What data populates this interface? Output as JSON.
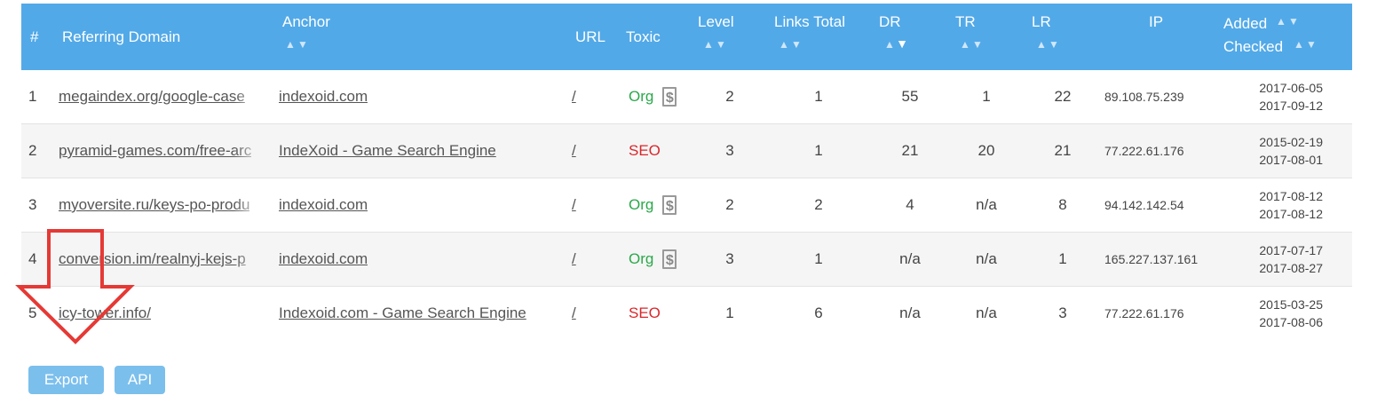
{
  "header": {
    "num": "#",
    "referring_domain": "Referring Domain",
    "anchor": "Anchor",
    "url": "URL",
    "toxic": "Toxic",
    "level": "Level",
    "links_total": "Links Total",
    "dr": "DR",
    "tr": "TR",
    "lr": "LR",
    "ip": "IP",
    "added": "Added",
    "checked": "Checked"
  },
  "rows": [
    {
      "num": "1",
      "domain": "megaindex.org/google-case",
      "anchor": "indexoid.com",
      "url": "/",
      "toxic": "Org",
      "paid_icon": "dollar-icon",
      "level": "2",
      "links": "1",
      "dr": "55",
      "tr": "1",
      "lr": "22",
      "ip": "89.108.75.239",
      "added": "2017-06-05",
      "checked": "2017-09-12"
    },
    {
      "num": "2",
      "domain": "pyramid-games.com/free-arc",
      "anchor": "IndeXoid - Game Search Engine",
      "url": "/",
      "toxic": "SEO",
      "level": "3",
      "links": "1",
      "dr": "21",
      "tr": "20",
      "lr": "21",
      "ip": "77.222.61.176",
      "added": "2015-02-19",
      "checked": "2017-08-01"
    },
    {
      "num": "3",
      "domain": "myoversite.ru/keys-po-produ",
      "anchor": "indexoid.com",
      "url": "/",
      "toxic": "Org",
      "paid_icon": "dollar-icon",
      "level": "2",
      "links": "2",
      "dr": "4",
      "tr": "n/a",
      "lr": "8",
      "ip": "94.142.142.54",
      "added": "2017-08-12",
      "checked": "2017-08-12"
    },
    {
      "num": "4",
      "domain": "conversion.im/realnyj-kejs-p",
      "anchor": "indexoid.com",
      "url": "/",
      "toxic": "Org",
      "paid_icon": "dollar-icon",
      "level": "3",
      "links": "1",
      "dr": "n/a",
      "tr": "n/a",
      "lr": "1",
      "ip": "165.227.137.161",
      "added": "2017-07-17",
      "checked": "2017-08-27"
    },
    {
      "num": "5",
      "domain": "icy-tower.info/",
      "anchor": "Indexoid.com - Game Search Engine",
      "url": "/",
      "toxic": "SEO",
      "level": "1",
      "links": "6",
      "dr": "n/a",
      "tr": "n/a",
      "lr": "3",
      "ip": "77.222.61.176",
      "added": "2015-03-25",
      "checked": "2017-08-06"
    }
  ],
  "buttons": {
    "export": "Export",
    "api": "API"
  },
  "colors": {
    "header_bg": "#52a9e8",
    "org": "#2aa84a",
    "seo": "#d9262b",
    "annotation_arrow": "#e53935",
    "button_bg": "#7bbfed"
  },
  "sort": {
    "active_column": "DR",
    "direction": "descending"
  }
}
